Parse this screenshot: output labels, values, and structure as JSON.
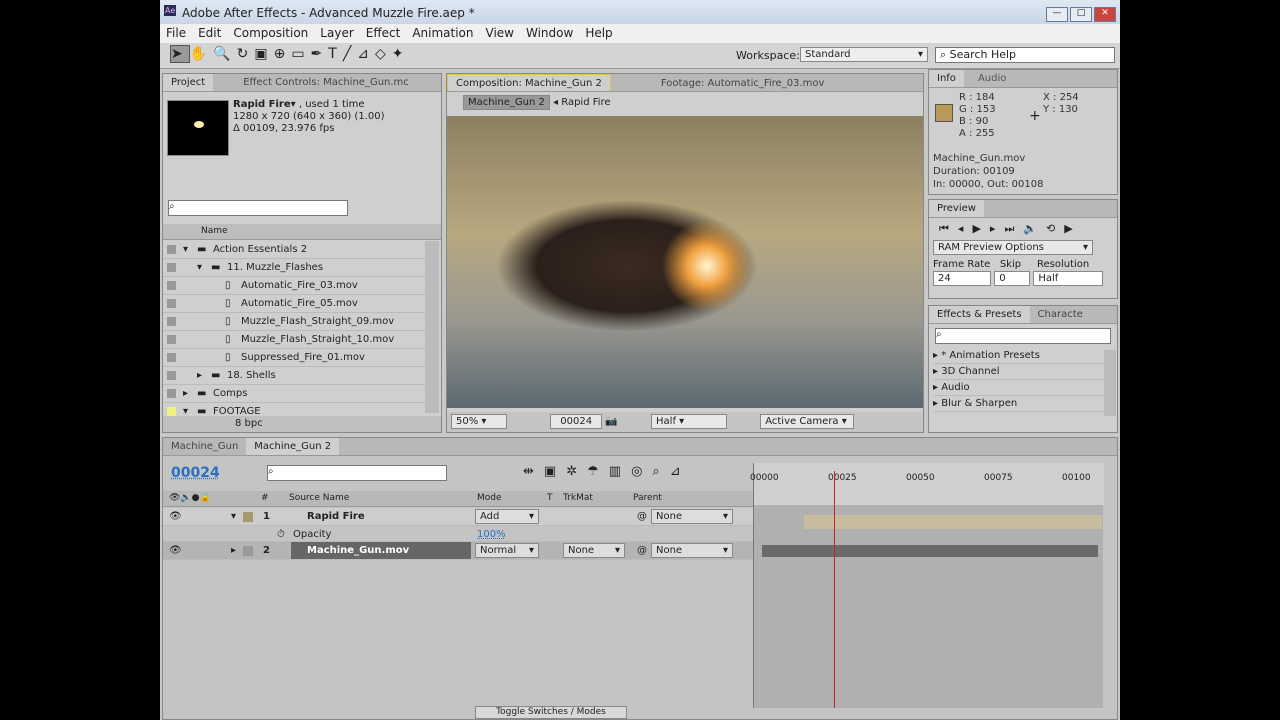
{
  "window": {
    "title": "Adobe After Effects - Advanced Muzzle Fire.aep *",
    "app_icon": "Ae"
  },
  "menu": [
    "File",
    "Edit",
    "Composition",
    "Layer",
    "Effect",
    "Animation",
    "View",
    "Window",
    "Help"
  ],
  "toolbar": {
    "workspace_label": "Workspace:",
    "workspace_value": "Standard",
    "search_help": "Search Help"
  },
  "project": {
    "tab": "Project",
    "tab2": "Effect Controls: Machine_Gun.mc",
    "item_name": "Rapid Fire▾",
    "item_used": ", used 1 time",
    "item_size": "1280 x 720  (640 x 360) (1.00)",
    "item_duration": "Δ 00109, 23.976 fps",
    "col_name": "Name",
    "items": [
      {
        "label": "Action Essentials 2",
        "indent": 1,
        "type": "folder",
        "open": true
      },
      {
        "label": "11. Muzzle_Flashes",
        "indent": 2,
        "type": "folder",
        "open": true
      },
      {
        "label": "Automatic_Fire_03.mov",
        "indent": 3,
        "type": "file"
      },
      {
        "label": "Automatic_Fire_05.mov",
        "indent": 3,
        "type": "file"
      },
      {
        "label": "Muzzle_Flash_Straight_09.mov",
        "indent": 3,
        "type": "file"
      },
      {
        "label": "Muzzle_Flash_Straight_10.mov",
        "indent": 3,
        "type": "file"
      },
      {
        "label": "Suppressed_Fire_01.mov",
        "indent": 3,
        "type": "file"
      },
      {
        "label": "18. Shells",
        "indent": 2,
        "type": "folder",
        "open": false
      },
      {
        "label": "Comps",
        "indent": 1,
        "type": "folder",
        "open": false
      },
      {
        "label": "FOOTAGE",
        "indent": 1,
        "type": "folder",
        "open": true
      }
    ],
    "bpc": "8 bpc"
  },
  "viewer": {
    "tab": "Composition: Machine_Gun 2",
    "tab2": "Footage: Automatic_Fire_03.mov",
    "crumb1": "Machine_Gun 2",
    "crumb2": "Rapid Fire",
    "zoom": "50%",
    "timecode": "00024",
    "resolution": "Half",
    "camera": "Active Camera"
  },
  "info": {
    "tab": "Info",
    "tab2": "Audio",
    "r": "R : 184",
    "g": "G : 153",
    "b": "B : 90",
    "a": "A : 255",
    "x": "X : 254",
    "y": "Y : 130",
    "file": "Machine_Gun.mov",
    "duration": "Duration: 00109",
    "inout": "In: 00000, Out: 00108",
    "swatch": "#b8995a"
  },
  "preview": {
    "tab": "Preview",
    "ram": "RAM Preview Options",
    "frame_rate": "Frame Rate",
    "skip": "Skip",
    "resolution": "Resolution",
    "fr_val": "24",
    "skip_val": "0",
    "res_val": "Half"
  },
  "effects": {
    "tab": "Effects & Presets",
    "tab2": "Characte",
    "items": [
      "* Animation Presets",
      "3D Channel",
      "Audio",
      "Blur & Sharpen"
    ]
  },
  "timeline": {
    "tab1": "Machine_Gun",
    "tab2": "Machine_Gun 2",
    "timecode": "00024",
    "ruler": [
      "00000",
      "00025",
      "00050",
      "00075",
      "00100"
    ],
    "cols": {
      "source": "Source Name",
      "mode": "Mode",
      "t": "T",
      "trkmat": "TrkMat",
      "parent": "Parent",
      "num": "#"
    },
    "layers": [
      {
        "num": "1",
        "name": "Rapid Fire",
        "mode": "Add",
        "trkmat": "",
        "parent": "None"
      },
      {
        "num": "2",
        "name": "Machine_Gun.mov",
        "mode": "Normal",
        "trkmat": "None",
        "parent": "None"
      }
    ],
    "opacity_label": "Opacity",
    "opacity_value": "100%",
    "toggle": "Toggle Switches / Modes"
  }
}
